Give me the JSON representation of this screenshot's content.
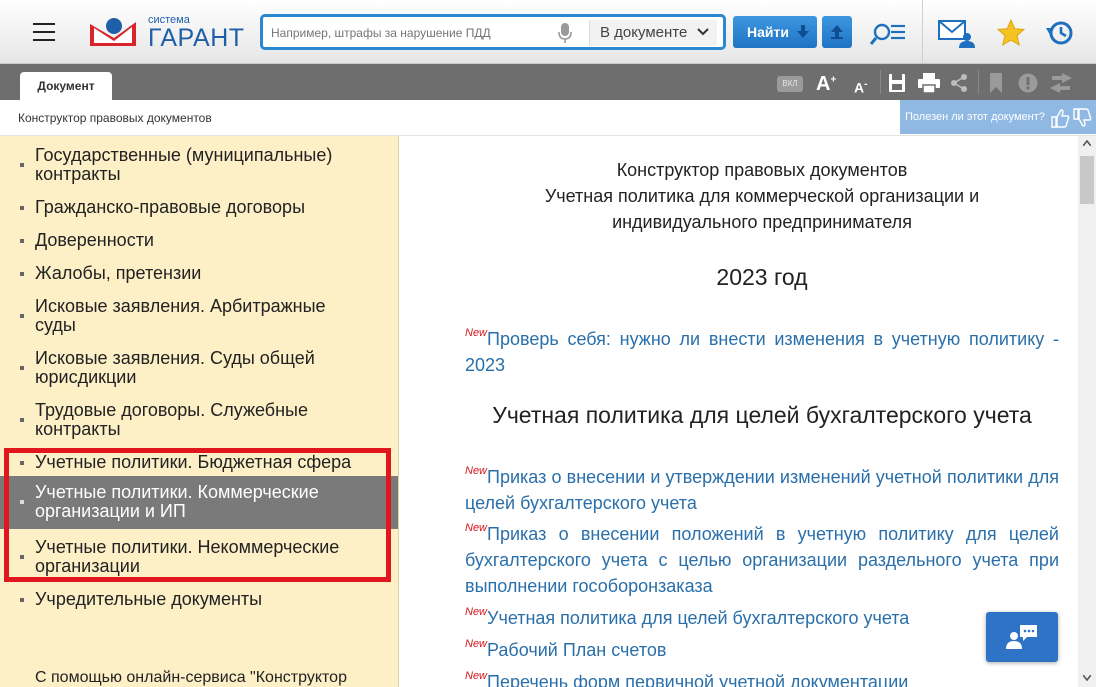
{
  "header": {
    "logo_small": "система",
    "logo_big": "ГАРАНТ",
    "search_placeholder": "Например, штрафы за нарушение ПДД",
    "search_scope": "В документе",
    "find_label": "Найти"
  },
  "tabs": {
    "document": "Документ"
  },
  "toolbar": {
    "reader_mode_badge": "ВКЛ",
    "font_up": "A",
    "font_down": "A"
  },
  "breadcrumb": "Конструктор правовых документов",
  "feedback_prompt": "Полезен ли этот документ?",
  "sidebar": {
    "items": [
      {
        "label": "Государственные (муниципальные) контракты",
        "active": false
      },
      {
        "label": "Гражданско-правовые договоры",
        "active": false
      },
      {
        "label": "Доверенности",
        "active": false
      },
      {
        "label": "Жалобы, претензии",
        "active": false
      },
      {
        "label": "Исковые заявления. Арбитражные суды",
        "active": false
      },
      {
        "label": "Исковые заявления. Суды общей юрисдикции",
        "active": false
      },
      {
        "label": "Трудовые договоры. Служебные контракты",
        "active": false
      },
      {
        "label": "Учетные политики. Бюджетная сфера",
        "active": false
      },
      {
        "label": "Учетные политики. Коммерческие организации и ИП",
        "active": true
      },
      {
        "label": "Учетные политики. Некоммерческие организации",
        "active": false
      },
      {
        "label": "Учредительные документы",
        "active": false
      }
    ],
    "note": "С помощью онлайн-сервиса \"Конструктор"
  },
  "document": {
    "title_lines": [
      "Конструктор правовых документов",
      "Учетная политика для коммерческой организации и",
      "индивидуального предпринимателя"
    ],
    "year": "2023 год",
    "section_title": "Учетная политика для целей бухгалтерского учета",
    "new_marker": "New",
    "links": [
      "Проверь себя: нужно ли внести изменения в учетную политику - 2023",
      "Приказ о внесении и утверждении изменений учетной политики для целей бухгалтерского учета",
      "Приказ о внесении положений в учетную политику для целей бухгалтерского учета с целью организации раздельного учета при выполнении гособоронзаказа",
      "Учетная политика для целей бухгалтерского учета",
      "Рабочий План счетов",
      "Перечень форм первичной учетной документации"
    ]
  },
  "colors": {
    "accent_blue": "#2a88d0",
    "link_blue": "#2a6faa",
    "sidebar_bg": "#fdf0c7",
    "active_item_bg": "#7a7a7a",
    "highlight_red": "#e0171e",
    "new_marker_red": "#d3151b"
  }
}
